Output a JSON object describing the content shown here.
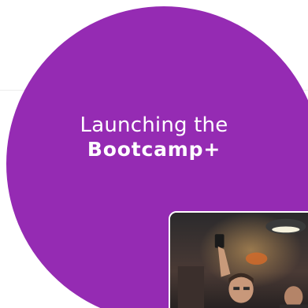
{
  "hero": {
    "title_line1": "Launching the",
    "title_line2": "Bootcamp+"
  },
  "photo": {
    "icon": "event-photo"
  },
  "colors": {
    "circle": "#952bb3",
    "background": "#ffffff",
    "text": "#ffffff"
  }
}
